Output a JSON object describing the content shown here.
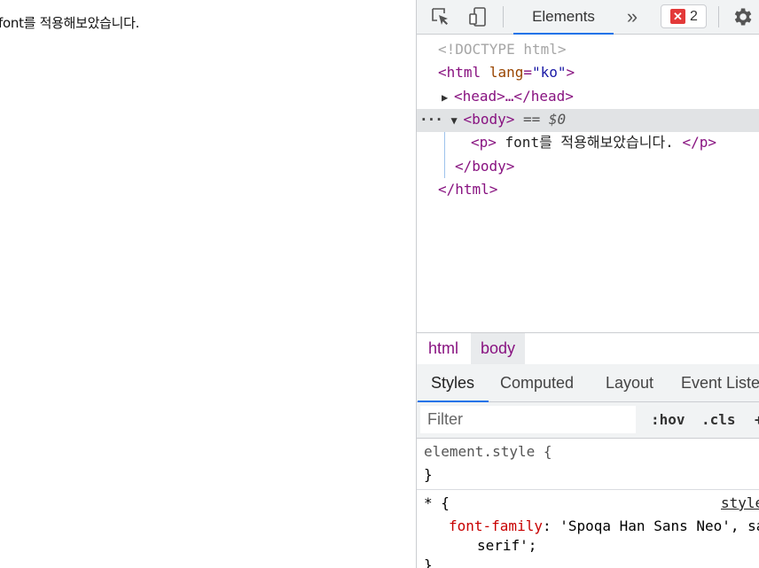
{
  "page": {
    "paragraph": "font를 적용해보았습니다."
  },
  "toolbar": {
    "elements_tab": "Elements",
    "more_tabs": "»",
    "error_count": "2"
  },
  "dom": {
    "doctype": "<!DOCTYPE html>",
    "html_open_tag": "<html",
    "html_attr_name": "lang",
    "html_attr_eq": "=",
    "html_attr_value": "\"ko\"",
    "html_close_bracket": ">",
    "head_collapsed": "<head>…</head>",
    "selection_dots": "···",
    "body_open": "<body>",
    "body_eq": "== $0",
    "p_open": "<p>",
    "p_text": " font를 적용해보았습니다. ",
    "p_close": "</p>",
    "body_close": "</body>",
    "html_close": "</html>"
  },
  "breadcrumbs": [
    "html",
    "body"
  ],
  "styles_tabs": [
    "Styles",
    "Computed",
    "Layout",
    "Event Listeners"
  ],
  "filter": {
    "placeholder": "Filter",
    "hov": ":hov",
    "cls": ".cls",
    "plus": "+"
  },
  "rules": {
    "element_style_selector": "element.style {",
    "element_style_close": "}",
    "star_selector": "* {",
    "star_source": "style.css",
    "prop_name": "font-family",
    "prop_colon": ": ",
    "prop_value_line1": "'Spoqa Han Sans Neo', sans-",
    "prop_value_line2": "serif';",
    "star_close": "}"
  }
}
